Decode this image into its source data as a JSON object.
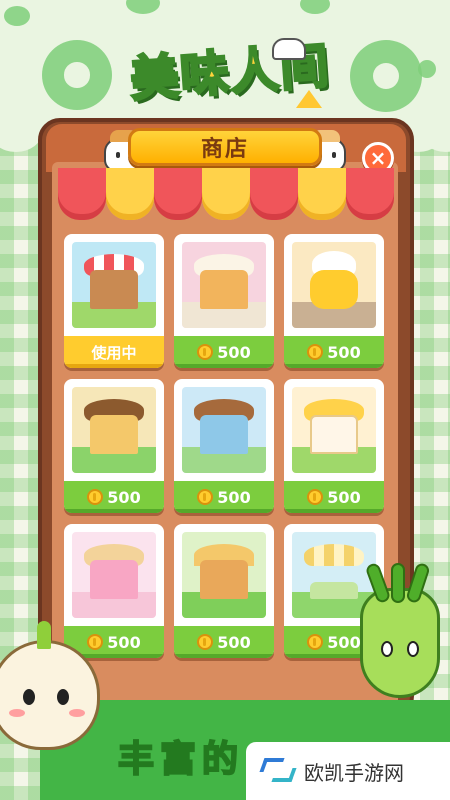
{
  "game": {
    "logo_text": "美味人间"
  },
  "shop": {
    "title": "商店",
    "close_symbol": "×",
    "items": [
      {
        "price_label": "使用中",
        "state": "in-use",
        "theme": "market-stall"
      },
      {
        "price_label": "500",
        "state": "buy",
        "theme": "cake-house"
      },
      {
        "price_label": "500",
        "state": "buy",
        "theme": "chick-car"
      },
      {
        "price_label": "500",
        "state": "buy",
        "theme": "tree-house"
      },
      {
        "price_label": "500",
        "state": "buy",
        "theme": "bus-house"
      },
      {
        "price_label": "500",
        "state": "buy",
        "theme": "castle-house"
      },
      {
        "price_label": "500",
        "state": "buy",
        "theme": "candy-house"
      },
      {
        "price_label": "500",
        "state": "buy",
        "theme": "tent-garden"
      },
      {
        "price_label": "500",
        "state": "buy",
        "theme": "awning-park"
      }
    ]
  },
  "banner": {
    "text": "丰富的"
  },
  "watermark": {
    "text": "欧凯手游网"
  },
  "colors": {
    "buy_green": "#7ccd3e",
    "in_use_yellow": "#ffcc2e",
    "panel_brown": "#8c4a2b",
    "awning_red": "#f0555a",
    "awning_yellow": "#ffd24a"
  }
}
